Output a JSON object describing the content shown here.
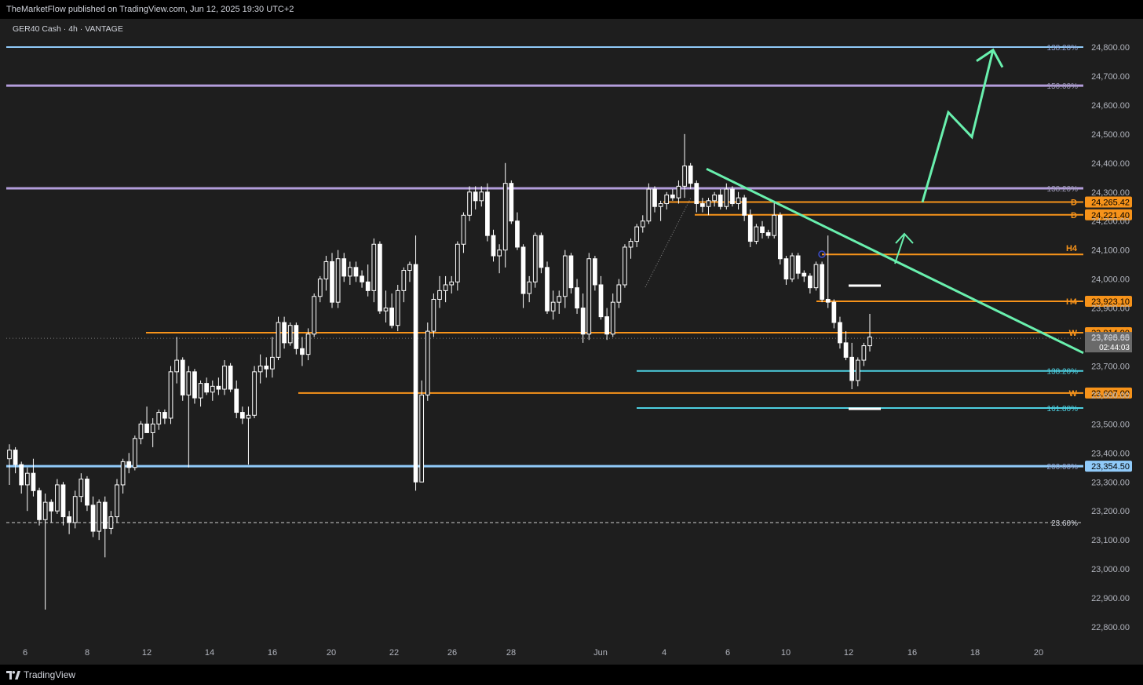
{
  "header": {
    "publish_text": "TheMarketFlow published on TradingView.com, Jun 12, 2025 19:30 UTC+2"
  },
  "footer": {
    "brand": "TradingView"
  },
  "colors": {
    "background": "#1e1e1e",
    "candle_body": "#ffffff",
    "orange_level": "#f7931a",
    "purple_fib": "#b39ddb",
    "blue_fib": "#90caf9",
    "cyan_fib": "#4dd0e1",
    "green_trend": "#69f0ae",
    "axis_text": "#b2b5be"
  },
  "chart_data": {
    "type": "candlestick",
    "symbol_label": "GER40 Cash · 4h · VANTAGE",
    "ylim": [
      22740,
      24880
    ],
    "x_ticks": [
      "6",
      "8",
      "12",
      "14",
      "16",
      "20",
      "22",
      "26",
      "28",
      "Jun",
      "4",
      "6",
      "10",
      "12",
      "16",
      "18",
      "20"
    ],
    "y_ticks": [
      "22,800.00",
      "22,900.00",
      "23,000.00",
      "23,100.00",
      "23,200.00",
      "23,300.00",
      "23,400.00",
      "23,500.00",
      "23,600.00",
      "23,700.00",
      "23,800.00",
      "23,900.00",
      "24,000.00",
      "24,100.00",
      "24,200.00",
      "24,300.00",
      "24,400.00",
      "24,500.00",
      "24,600.00",
      "24,700.00",
      "24,800.00"
    ],
    "levels": [
      {
        "price": 24800.0,
        "label": "138.20%",
        "kind": "fib-blue",
        "extent": "full"
      },
      {
        "price": 24667.0,
        "label": "150.00%",
        "kind": "fib-purple",
        "extent": "full"
      },
      {
        "price": 24313.0,
        "label": "138.20%",
        "kind": "fib-purple",
        "extent": "full"
      },
      {
        "price": 24265.42,
        "label": "D",
        "tag": "24,265.42",
        "kind": "orange",
        "extent": "from-jun4"
      },
      {
        "price": 24221.4,
        "label": "D",
        "tag": "24,221.40",
        "kind": "orange",
        "extent": "from-jun4b"
      },
      {
        "price": 24085.0,
        "label": "H4",
        "tag": "",
        "kind": "orange",
        "extent": "from-jun11"
      },
      {
        "price": 23923.1,
        "label": "H4",
        "tag": "23,923.10",
        "kind": "orange",
        "extent": "from-jun10"
      },
      {
        "price": 23814.9,
        "label": "W",
        "tag": "23,814.90",
        "kind": "orange",
        "extent": "from-may12"
      },
      {
        "price": 23683.0,
        "label": "138.20%",
        "kind": "fib-cyan",
        "extent": "from-jun3"
      },
      {
        "price": 23607.0,
        "label": "W",
        "tag": "23,607.00",
        "kind": "orange",
        "extent": "from-may16"
      },
      {
        "price": 23555.0,
        "label": "161.80%",
        "kind": "fib-cyan",
        "extent": "from-jun3"
      },
      {
        "price": 23354.5,
        "label": "200.00%",
        "tag": "23,354.50",
        "kind": "fib-blue-bold",
        "extent": "full"
      },
      {
        "price": 23160.0,
        "label": "23.60%",
        "kind": "dashed-white",
        "extent": "full"
      }
    ],
    "current_price": {
      "price": "23,795.65",
      "countdown": "02:44:03"
    },
    "candles": [
      [
        23380,
        23430,
        23290,
        23410
      ],
      [
        23410,
        23420,
        23330,
        23360
      ],
      [
        23360,
        23370,
        23260,
        23290
      ],
      [
        23290,
        23350,
        23200,
        23330
      ],
      [
        23330,
        23380,
        23250,
        23270
      ],
      [
        23270,
        23280,
        23150,
        23170
      ],
      [
        23170,
        23260,
        22860,
        23230
      ],
      [
        23230,
        23240,
        23160,
        23200
      ],
      [
        23200,
        23310,
        23190,
        23290
      ],
      [
        23290,
        23300,
        23150,
        23180
      ],
      [
        23180,
        23200,
        23120,
        23160
      ],
      [
        23160,
        23270,
        23140,
        23250
      ],
      [
        23250,
        23330,
        23230,
        23310
      ],
      [
        23310,
        23320,
        23200,
        23220
      ],
      [
        23220,
        23250,
        23110,
        23130
      ],
      [
        23130,
        23240,
        23100,
        23230
      ],
      [
        23230,
        23250,
        23040,
        23140
      ],
      [
        23140,
        23200,
        23120,
        23180
      ],
      [
        23180,
        23310,
        23160,
        23290
      ],
      [
        23290,
        23380,
        23260,
        23370
      ],
      [
        23370,
        23400,
        23330,
        23350
      ],
      [
        23350,
        23460,
        23340,
        23450
      ],
      [
        23450,
        23510,
        23430,
        23500
      ],
      [
        23500,
        23560,
        23480,
        23470
      ],
      [
        23470,
        23520,
        23420,
        23500
      ],
      [
        23500,
        23550,
        23480,
        23540
      ],
      [
        23540,
        23550,
        23500,
        23520
      ],
      [
        23520,
        23700,
        23500,
        23680
      ],
      [
        23680,
        23800,
        23640,
        23720
      ],
      [
        23720,
        23730,
        23580,
        23600
      ],
      [
        23600,
        23700,
        23350,
        23680
      ],
      [
        23680,
        23690,
        23570,
        23590
      ],
      [
        23590,
        23650,
        23560,
        23640
      ],
      [
        23640,
        23660,
        23600,
        23610
      ],
      [
        23610,
        23650,
        23580,
        23630
      ],
      [
        23630,
        23660,
        23600,
        23620
      ],
      [
        23620,
        23720,
        23600,
        23700
      ],
      [
        23700,
        23710,
        23610,
        23620
      ],
      [
        23620,
        23650,
        23520,
        23540
      ],
      [
        23540,
        23560,
        23500,
        23520
      ],
      [
        23520,
        23560,
        23360,
        23530
      ],
      [
        23530,
        23700,
        23520,
        23680
      ],
      [
        23680,
        23740,
        23640,
        23700
      ],
      [
        23700,
        23730,
        23660,
        23690
      ],
      [
        23690,
        23800,
        23660,
        23730
      ],
      [
        23730,
        23870,
        23720,
        23850
      ],
      [
        23850,
        23870,
        23760,
        23780
      ],
      [
        23780,
        23850,
        23770,
        23840
      ],
      [
        23840,
        23850,
        23740,
        23760
      ],
      [
        23760,
        23800,
        23700,
        23740
      ],
      [
        23740,
        23830,
        23720,
        23810
      ],
      [
        23810,
        23950,
        23800,
        23940
      ],
      [
        23940,
        24010,
        23920,
        24000
      ],
      [
        24000,
        24080,
        23960,
        24060
      ],
      [
        24060,
        24090,
        23900,
        23920
      ],
      [
        23920,
        24100,
        23900,
        24070
      ],
      [
        24070,
        24090,
        23990,
        24010
      ],
      [
        24010,
        24060,
        23980,
        24040
      ],
      [
        24040,
        24060,
        23990,
        24010
      ],
      [
        24010,
        24030,
        23970,
        23990
      ],
      [
        23990,
        24050,
        23940,
        23960
      ],
      [
        23960,
        24140,
        23920,
        24120
      ],
      [
        24120,
        24130,
        23880,
        23890
      ],
      [
        23890,
        23960,
        23850,
        23900
      ],
      [
        23900,
        23950,
        23830,
        23840
      ],
      [
        23840,
        23980,
        23820,
        23960
      ],
      [
        23960,
        24040,
        23920,
        24030
      ],
      [
        24030,
        24060,
        23990,
        24050
      ],
      [
        24050,
        24150,
        23270,
        23300
      ],
      [
        23300,
        23650,
        23300,
        23600
      ],
      [
        23600,
        23850,
        23580,
        23820
      ],
      [
        23820,
        23950,
        23800,
        23930
      ],
      [
        23930,
        24010,
        23900,
        23960
      ],
      [
        23960,
        24010,
        23920,
        23980
      ],
      [
        23980,
        24010,
        23950,
        23990
      ],
      [
        23990,
        24130,
        23960,
        24120
      ],
      [
        24120,
        24230,
        24090,
        24220
      ],
      [
        24220,
        24320,
        24200,
        24300
      ],
      [
        24300,
        24320,
        24240,
        24270
      ],
      [
        24270,
        24320,
        24250,
        24300
      ],
      [
        24300,
        24330,
        24130,
        24150
      ],
      [
        24150,
        24170,
        24060,
        24080
      ],
      [
        24080,
        24120,
        24020,
        24100
      ],
      [
        24100,
        24400,
        24040,
        24330
      ],
      [
        24330,
        24340,
        24190,
        24200
      ],
      [
        24200,
        24230,
        24100,
        24110
      ],
      [
        24110,
        24120,
        23900,
        23950
      ],
      [
        23950,
        24010,
        23920,
        23990
      ],
      [
        23990,
        24160,
        23970,
        24150
      ],
      [
        24150,
        24160,
        24020,
        24040
      ],
      [
        24040,
        24060,
        23880,
        23890
      ],
      [
        23890,
        23960,
        23860,
        23920
      ],
      [
        23920,
        23960,
        23880,
        23940
      ],
      [
        23940,
        24100,
        23900,
        24080
      ],
      [
        24080,
        24090,
        23950,
        23970
      ],
      [
        23970,
        24000,
        23880,
        23900
      ],
      [
        23900,
        23950,
        23780,
        23810
      ],
      [
        23810,
        24090,
        23790,
        24070
      ],
      [
        24070,
        24080,
        23960,
        23980
      ],
      [
        23980,
        24010,
        23860,
        23870
      ],
      [
        23870,
        23900,
        23790,
        23810
      ],
      [
        23810,
        23950,
        23800,
        23920
      ],
      [
        23920,
        24000,
        23900,
        23980
      ],
      [
        23980,
        24120,
        23970,
        24110
      ],
      [
        24110,
        24140,
        24070,
        24130
      ],
      [
        24130,
        24190,
        24110,
        24180
      ],
      [
        24180,
        24220,
        24160,
        24200
      ],
      [
        24200,
        24330,
        24190,
        24310
      ],
      [
        24310,
        24320,
        24230,
        24250
      ],
      [
        24250,
        24270,
        24200,
        24260
      ],
      [
        24260,
        24300,
        24240,
        24290
      ],
      [
        24290,
        24310,
        24270,
        24280
      ],
      [
        24280,
        24340,
        24260,
        24320
      ],
      [
        24320,
        24500,
        24280,
        24390
      ],
      [
        24390,
        24400,
        24310,
        24330
      ],
      [
        24330,
        24340,
        24230,
        24260
      ],
      [
        24260,
        24280,
        24230,
        24250
      ],
      [
        24250,
        24280,
        24220,
        24270
      ],
      [
        24270,
        24300,
        24250,
        24290
      ],
      [
        24290,
        24310,
        24240,
        24250
      ],
      [
        24250,
        24330,
        24240,
        24310
      ],
      [
        24310,
        24320,
        24250,
        24260
      ],
      [
        24260,
        24300,
        24240,
        24280
      ],
      [
        24280,
        24290,
        24200,
        24220
      ],
      [
        24220,
        24240,
        24110,
        24130
      ],
      [
        24130,
        24190,
        24120,
        24180
      ],
      [
        24180,
        24200,
        24140,
        24160
      ],
      [
        24160,
        24170,
        24140,
        24150
      ],
      [
        24150,
        24270,
        24140,
        24220
      ],
      [
        24220,
        24230,
        24050,
        24070
      ],
      [
        24070,
        24080,
        23980,
        24000
      ],
      [
        24000,
        24090,
        23990,
        24080
      ],
      [
        24080,
        24090,
        24000,
        24020
      ],
      [
        24020,
        24030,
        23990,
        24010
      ],
      [
        24010,
        24020,
        23950,
        23970
      ],
      [
        23970,
        24060,
        23960,
        24050
      ],
      [
        24050,
        24060,
        23920,
        23930
      ],
      [
        23930,
        24150,
        23900,
        23920
      ],
      [
        23920,
        23930,
        23830,
        23850
      ],
      [
        23850,
        23870,
        23760,
        23780
      ],
      [
        23780,
        23820,
        23720,
        23730
      ],
      [
        23730,
        23780,
        23620,
        23650
      ],
      [
        23650,
        23730,
        23630,
        23720
      ],
      [
        23720,
        23780,
        23700,
        23770
      ],
      [
        23770,
        23880,
        23750,
        23800
      ]
    ],
    "trend_line": {
      "from_price": 24380,
      "to_price": 23745
    },
    "projection": [
      24265,
      24575,
      24490,
      24790
    ]
  }
}
